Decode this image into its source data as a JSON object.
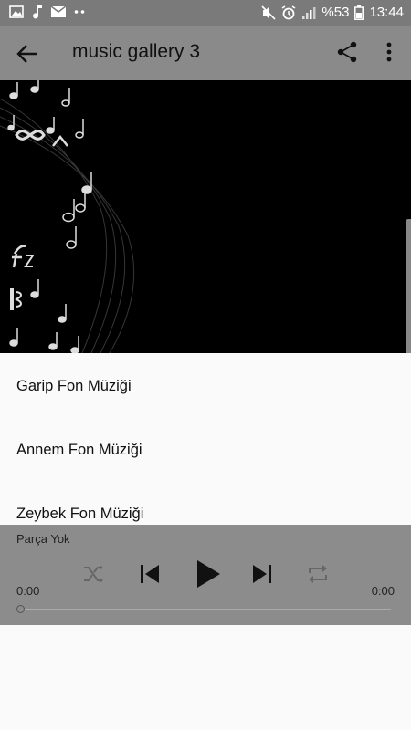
{
  "status_bar": {
    "battery": "%53",
    "time": "13:44"
  },
  "app_bar": {
    "title": "music gallery 3"
  },
  "list": {
    "items": [
      {
        "label": "Garip Fon Müziği"
      },
      {
        "label": "Annem Fon Müziği"
      },
      {
        "label": "Zeybek Fon Müziği"
      }
    ]
  },
  "player": {
    "track_label": "Parça Yok",
    "current_time": "0:00",
    "total_time": "0:00",
    "progress": 0
  },
  "colors": {
    "status_bar_bg": "#7a7a7a",
    "app_bar_bg": "#8a8a8a",
    "player_bg": "#8c8c8c",
    "hero_bg": "#000000"
  },
  "icons": [
    "image-icon",
    "music-note-icon",
    "mail-icon",
    "mute-icon",
    "alarm-icon",
    "signal-icon",
    "battery-icon",
    "back-arrow-icon",
    "share-icon",
    "more-vert-icon",
    "shuffle-icon",
    "skip-previous-icon",
    "play-icon",
    "skip-next-icon",
    "repeat-icon"
  ]
}
